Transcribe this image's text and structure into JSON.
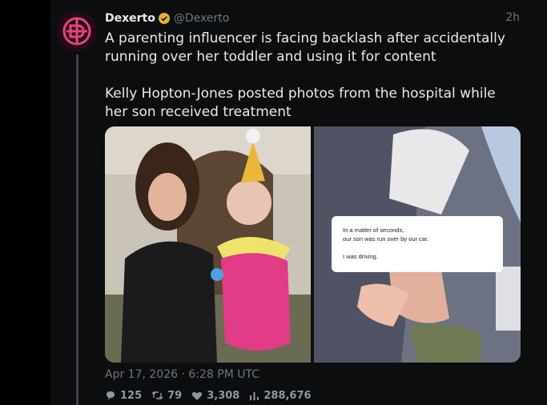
{
  "tweet": {
    "author_name": "Dexerto",
    "author_handle": "@Dexerto",
    "relative_time": "2h",
    "text_line1": "A parenting influencer is facing backlash after accidentally running over her toddler and using it for content",
    "text_line2": "Kelly Hopton-Jones posted photos from the hospital while her son received treatment",
    "timestamp": "Apr 17, 2026 · 6:28 PM UTC",
    "stats": {
      "replies": "125",
      "reposts": "79",
      "likes": "3,308",
      "views": "288,676"
    }
  },
  "media_overlay": {
    "line1": "In a matter of seconds,",
    "line2": "our son was run over by our car.",
    "line3": "I was driving."
  },
  "colors": {
    "background": "#000000",
    "text": "#e7e9ea",
    "muted": "#6e767d",
    "verified": "#e8b02f",
    "avatar_brand": "#e8447a"
  },
  "icons": {
    "verified": "verified-badge-icon",
    "reply": "reply-icon",
    "repost": "repost-icon",
    "like": "heart-icon",
    "views": "views-icon"
  }
}
